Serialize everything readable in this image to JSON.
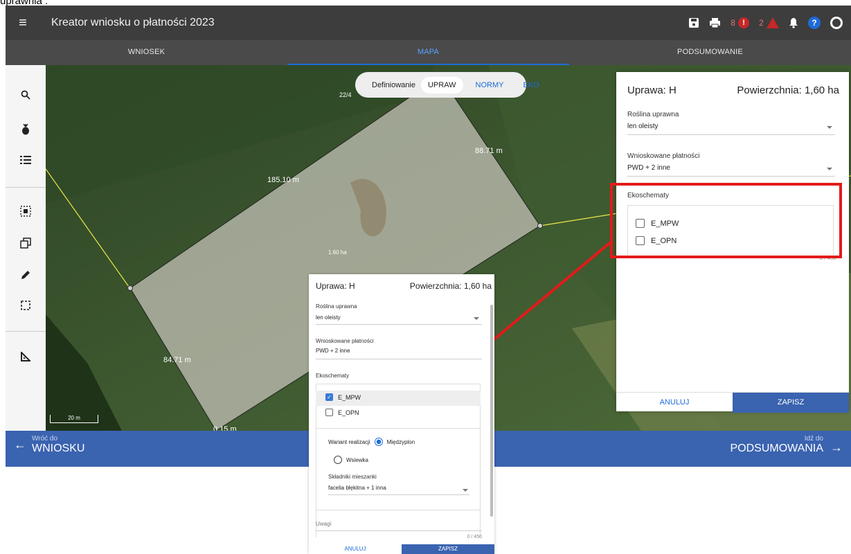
{
  "doc_text": "uprawnia :",
  "app": {
    "title": "Kreator wniosku o płatności 2023",
    "error_count": "8",
    "warning_count": "2",
    "tabs": [
      "WNIOSEK",
      "MAPA",
      "PODSUMOWANIE"
    ]
  },
  "map": {
    "define_label": "Definiowanie",
    "options": [
      "UPRAW",
      "NORMY",
      "EKO"
    ],
    "parcel_id": "22/4",
    "area_label": "1.60 ha",
    "dim_top": "185.10 m",
    "dim_right": "88.71 m",
    "dim_left": "84.71 m",
    "dim_bottom": "0.15 m",
    "scale": "20 m"
  },
  "bottom": {
    "back_small": "Wróć do",
    "back_big": "WNIOSKU",
    "fwd_small": "Idź do",
    "fwd_big": "PODSUMOWANIA"
  },
  "panel": {
    "uprawa": "Uprawa: H",
    "powierzchnia": "Powierzchnia: 1,60 ha",
    "roslina_label": "Roślina uprawna",
    "roslina_value": "len oleisty",
    "platnosci_label": "Wnioskowane płatności",
    "platnosci_value": "PWD + 2 inne",
    "eko_label": "Ekoschematy",
    "eko_items": [
      "E_MPW",
      "E_OPN"
    ],
    "counter": "0 / 450",
    "cancel": "ANULUJ",
    "save": "ZAPISZ"
  },
  "zoom": {
    "uprawa": "Uprawa: H",
    "powierzchnia": "Powierzchnia: 1,60 ha",
    "roslina_label": "Roślina uprawna",
    "roslina_value": "len oleisty",
    "platnosci_label": "Wnioskowane płatności",
    "platnosci_value": "PWD + 2 inne",
    "eko_label": "Ekoschematy",
    "eko_items": [
      "E_MPW",
      "E_OPN"
    ],
    "wariant_label": "Wariant realizacji",
    "wariant_options": [
      "Międzyplon",
      "Wsiewka"
    ],
    "skladniki_label": "Składniki mieszanki",
    "skladniki_value": "facelia błękitna + 1 inna",
    "uwagi_label": "Uwagi",
    "counter": "0 / 450",
    "cancel": "ANULUJ",
    "save": "ZAPISZ"
  },
  "colors": {
    "accent": "#1e6bd8",
    "highlight": "#e31a1a",
    "bar": "#3a63b0"
  }
}
